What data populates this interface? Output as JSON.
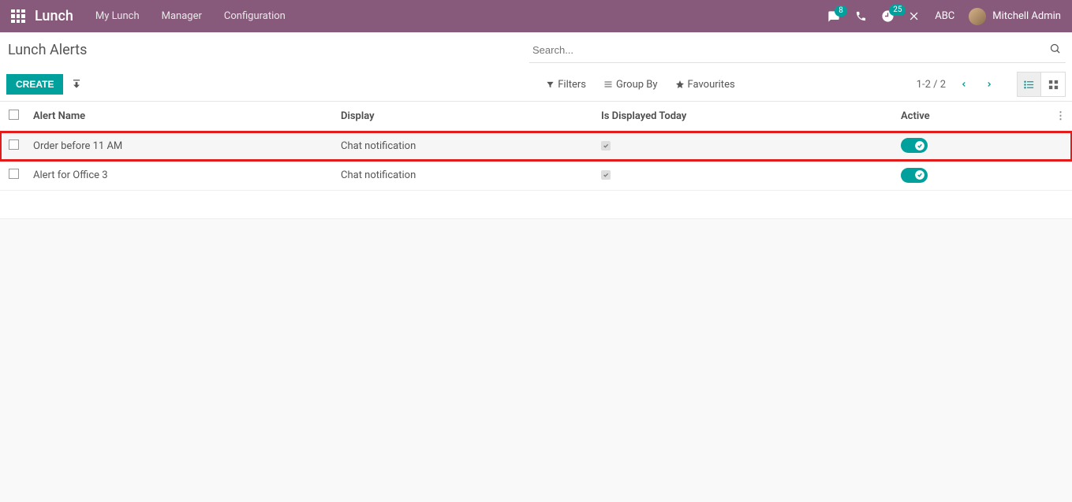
{
  "header": {
    "brand": "Lunch",
    "menus": [
      "My Lunch",
      "Manager",
      "Configuration"
    ],
    "messages_badge": "8",
    "activities_badge": "25",
    "company": "ABC",
    "user": "Mitchell Admin"
  },
  "breadcrumb": "Lunch Alerts",
  "buttons": {
    "create": "CREATE"
  },
  "search": {
    "placeholder": "Search...",
    "filters": "Filters",
    "groupby": "Group By",
    "favourites": "Favourites"
  },
  "pager": "1-2 / 2",
  "columns": {
    "name": "Alert Name",
    "display": "Display",
    "today": "Is Displayed Today",
    "active": "Active"
  },
  "rows": [
    {
      "name": "Order before 11 AM",
      "display": "Chat notification",
      "today": true,
      "active": true,
      "highlight": true
    },
    {
      "name": "Alert for Office 3",
      "display": "Chat notification",
      "today": true,
      "active": true,
      "highlight": false
    }
  ]
}
